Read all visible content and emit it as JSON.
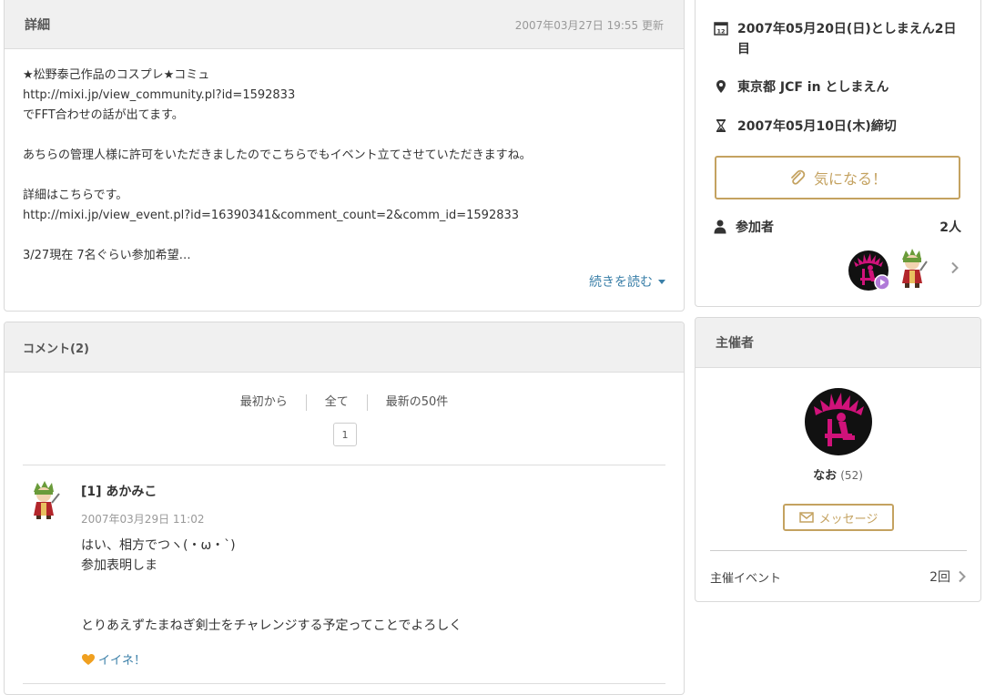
{
  "detail": {
    "title": "詳細",
    "updated": "2007年03月27日 19:55 更新",
    "lines": [
      "★松野泰己作品のコスプレ★コミュ",
      "http://mixi.jp/view_community.pl?id=1592833",
      "でFFT合わせの話が出てます。",
      "",
      "あちらの管理人様に許可をいただきましたのでこちらでもイベント立てさせていただきますね。",
      "",
      "詳細はこちらです。",
      "http://mixi.jp/view_event.pl?id=16390341&comment_count=2&comm_id=1592833",
      "",
      "3/27現在 7名ぐらい参加希望…"
    ],
    "read_more": "続きを読む"
  },
  "comments": {
    "title": "コメント(2)",
    "nav": [
      "最初から",
      "全て",
      "最新の50件"
    ],
    "page": "1",
    "items": [
      {
        "name": "[1] あかみこ",
        "date": "2007年03月29日 11:02",
        "lines": [
          "はい、相方でつヽ(・ω・`)",
          "参加表明しま",
          "",
          "",
          "とりあえずたまねぎ剣士をチャレンジする予定ってことでよろしく"
        ],
        "like": "イイネ！"
      }
    ]
  },
  "info": {
    "date": "2007年05月20日(日)としまえん2日目",
    "location": "東京都 JCF in としまえん",
    "deadline": "2007年05月10日(木)締切",
    "kininaru": "気になる！",
    "participants_label": "参加者",
    "participants_count": "2人"
  },
  "organizer": {
    "title": "主催者",
    "name": "なお",
    "count": "(52)",
    "message": "メッセージ",
    "events_label": "主催イベント",
    "events_count": "2回"
  },
  "colors": {
    "accent_gold": "#c4a260",
    "link_blue": "#3a7fa8",
    "avatar_magenta": "#d0127a"
  },
  "icons": [
    "calendar-icon",
    "location-pin-icon",
    "hourglass-icon",
    "paperclip-icon",
    "person-icon",
    "chevron-right-icon",
    "mail-icon",
    "heart-icon",
    "caret-down-icon"
  ]
}
